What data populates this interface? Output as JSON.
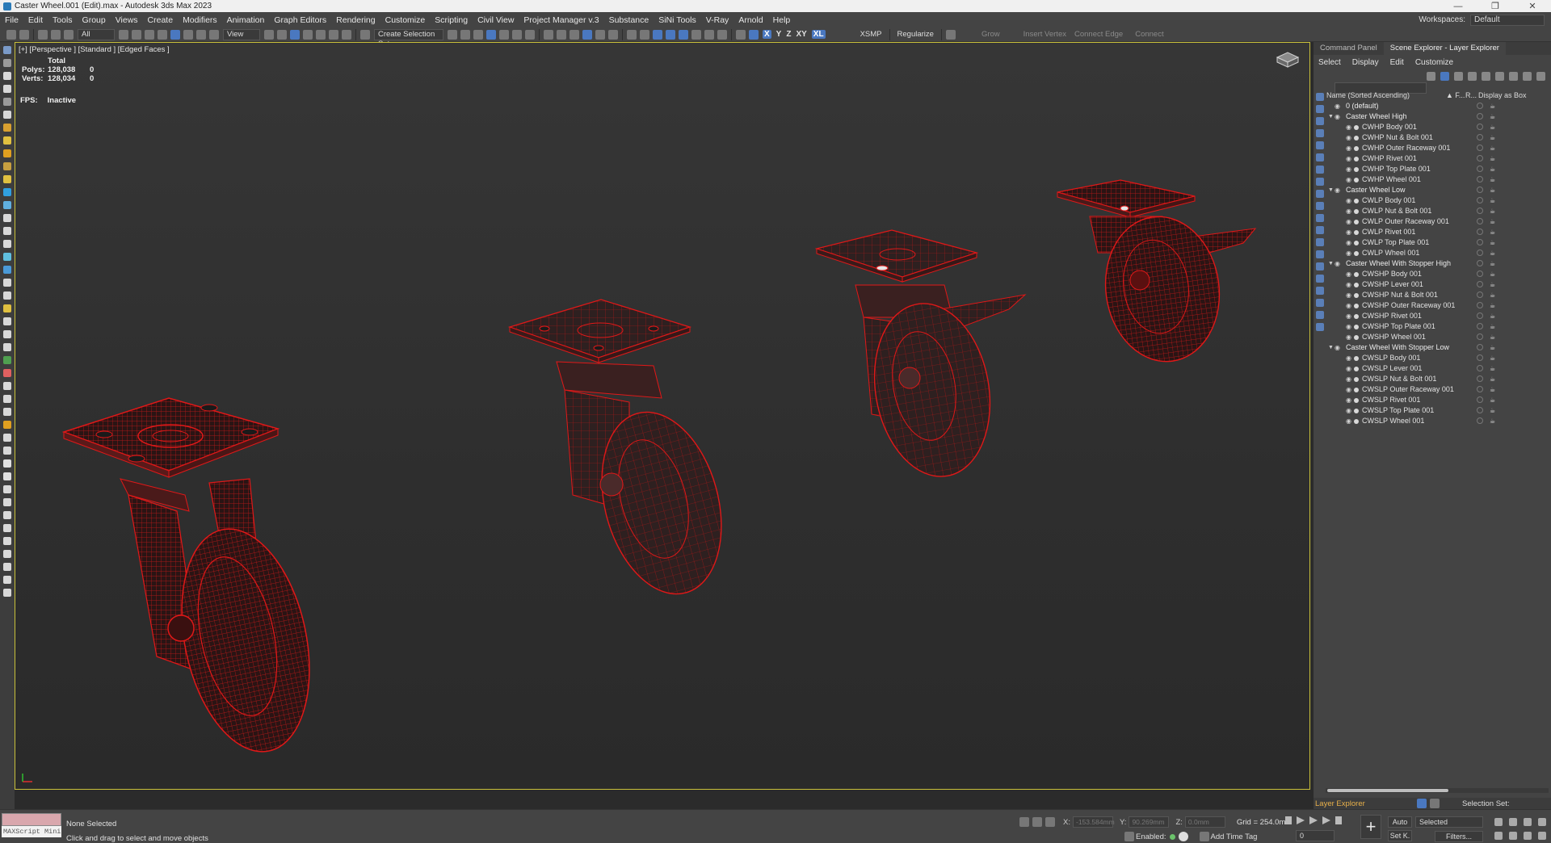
{
  "window": {
    "title": "Caster Wheel.001 (Edit).max - Autodesk 3ds Max 2023"
  },
  "menu": {
    "items": [
      "File",
      "Edit",
      "Tools",
      "Group",
      "Views",
      "Create",
      "Modifiers",
      "Animation",
      "Graph Editors",
      "Rendering",
      "Customize",
      "Scripting",
      "Civil View",
      "Project Manager v.3",
      "Substance",
      "SiNi Tools",
      "V-Ray",
      "Arnold",
      "Help"
    ],
    "workspaces_label": "Workspaces:",
    "workspace_value": "Default"
  },
  "toolbar": {
    "filter_select": "All",
    "view_select": "View",
    "selection_set": "Create Selection Set",
    "axis_x": "X",
    "axis_y": "Y",
    "axis_z": "Z",
    "axis_xy": "XY",
    "axis_xl": "XL",
    "xsmp": "XSMP",
    "regularize": "Regularize",
    "grow": "Grow",
    "insert_vertex": "Insert Vertex",
    "connect_edge": "Connect Edge",
    "connect": "Connect"
  },
  "viewport": {
    "label": "[+] [Perspective ] [Standard ] [Edged Faces ]",
    "stats": {
      "total_label": "Total",
      "polys_label": "Polys:",
      "polys_total": "128,038",
      "polys_selected": "0",
      "verts_label": "Verts:",
      "verts_total": "128,034",
      "verts_selected": "0"
    },
    "fps_label": "FPS:",
    "fps_value": "Inactive",
    "wire_color": "#e01818"
  },
  "right_panel": {
    "tabs": [
      "Command Panel",
      "Scene Explorer - Layer Explorer"
    ],
    "menu": [
      "Select",
      "Display",
      "Edit",
      "Customize"
    ],
    "columns": {
      "name": "Name (Sorted Ascending)",
      "frozen": "▲ F...",
      "render": "R...",
      "display_box": "Display as Box"
    },
    "tree": [
      {
        "name": "0 (default)",
        "level": 0,
        "layer": true
      },
      {
        "name": "Caster Wheel High",
        "level": 0,
        "layer": true,
        "expanded": true
      },
      {
        "name": "CWHP Body 001",
        "level": 1
      },
      {
        "name": "CWHP Nut & Bolt 001",
        "level": 1
      },
      {
        "name": "CWHP Outer Raceway 001",
        "level": 1
      },
      {
        "name": "CWHP Rivet 001",
        "level": 1
      },
      {
        "name": "CWHP Top Plate 001",
        "level": 1
      },
      {
        "name": "CWHP Wheel 001",
        "level": 1
      },
      {
        "name": "Caster Wheel Low",
        "level": 0,
        "layer": true,
        "expanded": true
      },
      {
        "name": "CWLP Body 001",
        "level": 1
      },
      {
        "name": "CWLP Nut & Bolt 001",
        "level": 1
      },
      {
        "name": "CWLP Outer Raceway 001",
        "level": 1
      },
      {
        "name": "CWLP Rivet 001",
        "level": 1
      },
      {
        "name": "CWLP Top Plate 001",
        "level": 1
      },
      {
        "name": "CWLP Wheel 001",
        "level": 1
      },
      {
        "name": "Caster Wheel With Stopper High",
        "level": 0,
        "layer": true,
        "expanded": true
      },
      {
        "name": "CWSHP Body 001",
        "level": 1
      },
      {
        "name": "CWSHP Lever 001",
        "level": 1
      },
      {
        "name": "CWSHP Nut & Bolt 001",
        "level": 1
      },
      {
        "name": "CWSHP Outer Raceway 001",
        "level": 1
      },
      {
        "name": "CWSHP Rivet 001",
        "level": 1
      },
      {
        "name": "CWSHP Top Plate 001",
        "level": 1
      },
      {
        "name": "CWSHP Wheel 001",
        "level": 1
      },
      {
        "name": "Caster Wheel With Stopper Low",
        "level": 0,
        "layer": true,
        "expanded": true
      },
      {
        "name": "CWSLP Body 001",
        "level": 1
      },
      {
        "name": "CWSLP Lever 001",
        "level": 1
      },
      {
        "name": "CWSLP Nut & Bolt 001",
        "level": 1
      },
      {
        "name": "CWSLP Outer Raceway 001",
        "level": 1
      },
      {
        "name": "CWSLP Rivet 001",
        "level": 1
      },
      {
        "name": "CWSLP Top Plate 001",
        "level": 1
      },
      {
        "name": "CWSLP Wheel 001",
        "level": 1
      }
    ],
    "footer_explorer": "Layer Explorer",
    "footer_selection_set": "Selection Set:"
  },
  "status": {
    "maxscript": "MAXScript Mini",
    "selection": "None Selected",
    "prompt": "Click and drag to select and move objects",
    "x_label": "X:",
    "x_value": "-153.584mm",
    "y_label": "Y:",
    "y_value": "90.269mm",
    "z_label": "Z:",
    "z_value": "0.0mm",
    "grid": "Grid = 254.0mm",
    "enabled_label": "Enabled:",
    "add_time_tag": "Add Time Tag",
    "auto_key": "Auto",
    "set_key": "Set K.",
    "key_filter": "Selected",
    "filters": "Filters...",
    "frame": "0"
  }
}
